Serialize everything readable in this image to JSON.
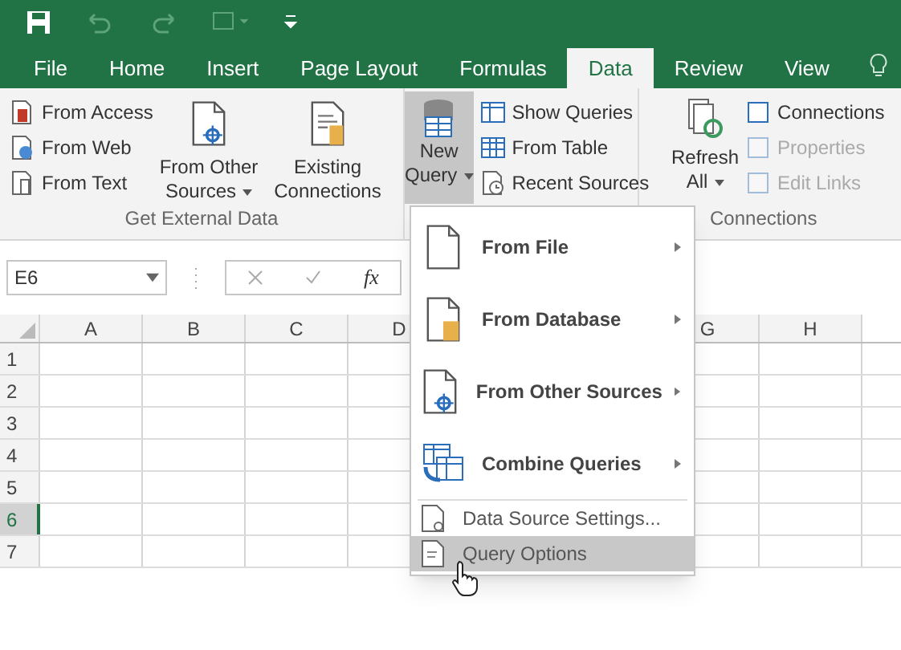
{
  "quick_access": {
    "buttons": [
      {
        "kind": "save"
      },
      {
        "kind": "undo"
      },
      {
        "kind": "redo"
      },
      {
        "kind": "touch"
      },
      {
        "kind": "customize"
      }
    ]
  },
  "tabs": [
    {
      "label": "File",
      "selected": false
    },
    {
      "label": "Home",
      "selected": false
    },
    {
      "label": "Insert",
      "selected": false
    },
    {
      "label": "Page Layout",
      "selected": false
    },
    {
      "label": "Formulas",
      "selected": false
    },
    {
      "label": "Data",
      "selected": true
    },
    {
      "label": "Review",
      "selected": false
    },
    {
      "label": "View",
      "selected": false
    }
  ],
  "ribbon": {
    "get_external_data": {
      "small": [
        {
          "label": "From Access",
          "kind": "access"
        },
        {
          "label": "From Web",
          "kind": "web"
        },
        {
          "label": "From Text",
          "kind": "text"
        }
      ],
      "from_other": {
        "line1": "From Other",
        "line2": "Sources"
      },
      "existing": {
        "line1": "Existing",
        "line2": "Connections"
      },
      "group_label": "Get External Data"
    },
    "new_query": {
      "line1": "New",
      "line2": "Query",
      "pressed": true,
      "small": [
        {
          "label": "Show Queries",
          "kind": "queries"
        },
        {
          "label": "From Table",
          "kind": "table"
        },
        {
          "label": "Recent Sources",
          "kind": "recent"
        }
      ]
    },
    "connections": {
      "refresh": {
        "line1": "Refresh",
        "line2": "All"
      },
      "small": [
        {
          "label": "Connections",
          "disabled": false
        },
        {
          "label": "Properties",
          "disabled": true
        },
        {
          "label": "Edit Links",
          "disabled": true
        }
      ],
      "group_label": "Connections"
    }
  },
  "formula_bar": {
    "name_box": "E6",
    "fx": "fx"
  },
  "sheet": {
    "columns_before_menu": [
      "A",
      "B",
      "C",
      "D"
    ],
    "columns_after_menu": [
      "G",
      "H"
    ],
    "rows": [
      {
        "label": "1",
        "selected": false
      },
      {
        "label": "2",
        "selected": false
      },
      {
        "label": "3",
        "selected": false
      },
      {
        "label": "4",
        "selected": false
      },
      {
        "label": "5",
        "selected": false
      },
      {
        "label": "6",
        "selected": true
      },
      {
        "label": "7",
        "selected": false
      }
    ]
  },
  "menu": {
    "items": [
      {
        "kind": "large",
        "label": "From File",
        "submenu": true,
        "selected": false
      },
      {
        "kind": "large",
        "label": "From Database",
        "submenu": true,
        "selected": false
      },
      {
        "kind": "large",
        "label": "From Other Sources",
        "submenu": true,
        "selected": false
      },
      {
        "kind": "large",
        "label": "Combine Queries",
        "submenu": true,
        "selected": false
      },
      {
        "kind": "small",
        "label": "Data Source Settings...",
        "submenu": false,
        "selected": false
      },
      {
        "kind": "small",
        "label": "Query Options",
        "submenu": false,
        "selected": true
      }
    ]
  }
}
